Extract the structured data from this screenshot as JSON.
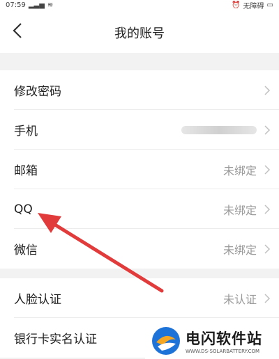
{
  "status_bar": {
    "time": "07:59",
    "carrier": "无障碍"
  },
  "header": {
    "title": "我的账号"
  },
  "groups": [
    {
      "items": [
        {
          "label": "修改密码",
          "status": ""
        },
        {
          "label": "手机",
          "status": ""
        },
        {
          "label": "邮箱",
          "status": "未绑定"
        },
        {
          "label": "QQ",
          "status": "未绑定"
        },
        {
          "label": "微信",
          "status": "未绑定"
        }
      ]
    },
    {
      "items": [
        {
          "label": "人脸认证",
          "status": "未认证"
        },
        {
          "label": "银行卡实名认证",
          "status": ""
        }
      ]
    }
  ],
  "watermark": {
    "name": "电闪软件站",
    "url": "WWW.DS-SOLARBATTERY.COM"
  },
  "colors": {
    "arrow": "#e23b3b",
    "status_text": "#9a9a9a",
    "background": "#f2f2f2"
  },
  "icons": {
    "back": "chevron-left-icon",
    "row_arrow": "chevron-right-icon",
    "logo": "dianshan-logo-icon"
  }
}
